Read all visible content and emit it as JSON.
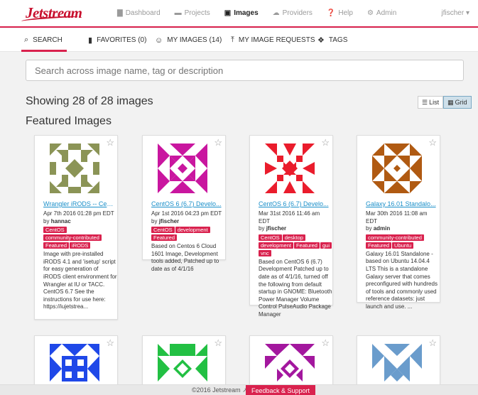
{
  "app": {
    "logo": "Jetstream"
  },
  "nav": {
    "items": [
      {
        "label": "Dashboard",
        "icon": "bar-chart-icon",
        "glyph": "▇"
      },
      {
        "label": "Projects",
        "icon": "folder-icon",
        "glyph": "▬"
      },
      {
        "label": "Images",
        "icon": "images-icon",
        "glyph": "▣"
      },
      {
        "label": "Providers",
        "icon": "cloud-icon",
        "glyph": "☁"
      },
      {
        "label": "Help",
        "icon": "help-icon",
        "glyph": "❓"
      },
      {
        "label": "Admin",
        "icon": "gear-icon",
        "glyph": "⚙"
      }
    ],
    "active": "Images",
    "user": "jfischer ▾"
  },
  "tabs": [
    {
      "label": "SEARCH",
      "icon": "search-icon",
      "glyph": "⌕"
    },
    {
      "label": "FAVORITES (0)",
      "icon": "bookmark-icon",
      "glyph": "▮"
    },
    {
      "label": "MY IMAGES (14)",
      "icon": "user-icon",
      "glyph": "☺"
    },
    {
      "label": "MY IMAGE REQUESTS",
      "icon": "upload-icon",
      "glyph": "⤒"
    },
    {
      "label": "TAGS",
      "icon": "tags-icon",
      "glyph": "❖"
    }
  ],
  "search": {
    "placeholder": "Search across image name, tag or description",
    "value": ""
  },
  "results": {
    "showing": "Showing 28 of 28 images"
  },
  "view": {
    "list": "List",
    "grid": "Grid",
    "selected": "Grid"
  },
  "featured": {
    "heading": "Featured Images"
  },
  "cards": [
    {
      "title": "Wrangler iRODS -- Cen...",
      "date": "Apr 7th 2016 01:28 pm EDT",
      "by_prefix": "by",
      "author": "hannac",
      "tags": [
        "CentOS",
        "community-contributed",
        "Featured",
        "iRODS"
      ],
      "description": "Image with pre-installed iRODS 4.1 and 'isetup' script for easy generation of iRODS client environment for Wrangler at IU or TACC. CentOS 6.7 See the instructions for use here: https://iujetstrea...",
      "color": "#8b9456"
    },
    {
      "title": "CentOS 6 (6.7) Develo...",
      "date": "Apr 1st 2016 04:23 pm EDT",
      "by_prefix": "by",
      "author": "jfischer",
      "tags": [
        "CentOS",
        "development",
        "Featured"
      ],
      "description": "Based on Centos 6 Cloud 1601 Image, Development tools added, Patched up to date as of 4/1/16",
      "color": "#c9169f"
    },
    {
      "title": "CentOS 6 (6.7) Develo...",
      "date": "Mar 31st 2016 11:46 am EDT",
      "by_prefix": "by",
      "author": "jfischer",
      "tags": [
        "CentOS",
        "desktop",
        "development",
        "Featured",
        "gui",
        "vnc"
      ],
      "description": "Based on CentOS 6 (6.7) Development Patched up to date as of 4/1/16, turned off the following from default startup in GNOME: Bluetooth Power Manager Volume Control PulseAudio Package Manager",
      "color": "#ea1c2c"
    },
    {
      "title": "Galaxy 16.01 Standalo...",
      "date": "Mar 30th 2016 11:08 am EDT",
      "by_prefix": "by",
      "author": "admin",
      "tags": [
        "community-contributed",
        "Featured",
        "Ubuntu"
      ],
      "description": "Galaxy 16.01 Standalone - based on Ubuntu 14.04.4 LTS This is a standalone Galaxy server that comes preconfigured with hundreds of tools and commonly used reference datasets: just launch and use. ...",
      "color": "#b05a12"
    }
  ],
  "cards_row2": [
    {
      "color": "#1f48e8"
    },
    {
      "color": "#22c043"
    },
    {
      "color": "#a3179e"
    },
    {
      "color": "#6a9ccc"
    }
  ],
  "footer": {
    "copyright": "©2016 Jetstream ↗",
    "feedback": "Feedback & Support"
  }
}
